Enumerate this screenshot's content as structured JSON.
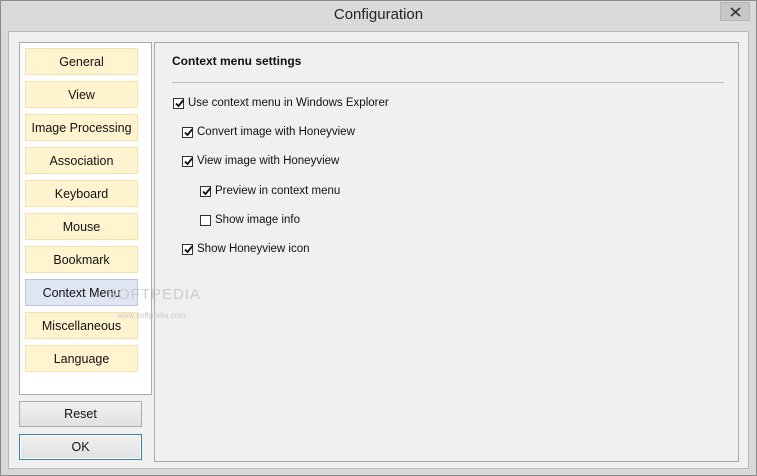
{
  "window": {
    "title": "Configuration"
  },
  "nav": {
    "items": [
      {
        "label": "General"
      },
      {
        "label": "View"
      },
      {
        "label": "Image Processing"
      },
      {
        "label": "Association"
      },
      {
        "label": "Keyboard"
      },
      {
        "label": "Mouse"
      },
      {
        "label": "Bookmark"
      },
      {
        "label": "Context Menu",
        "selected": true
      },
      {
        "label": "Miscellaneous"
      },
      {
        "label": "Language"
      }
    ]
  },
  "buttons": {
    "reset": "Reset",
    "ok": "OK"
  },
  "content": {
    "section_title": "Context menu settings",
    "options": [
      {
        "label": "Use context menu in Windows Explorer",
        "checked": true
      },
      {
        "label": "Convert image with Honeyview",
        "checked": true
      },
      {
        "label": "View image with Honeyview",
        "checked": true
      },
      {
        "label": "Preview in context menu",
        "checked": true
      },
      {
        "label": "Show image info",
        "checked": false
      },
      {
        "label": "Show Honeyview icon",
        "checked": true
      }
    ]
  },
  "watermark": {
    "text": "SOFTPEDIA",
    "url": "www.softpedia.com"
  },
  "colors": {
    "nav_item_bg": "#fff4cf",
    "nav_item_selected_bg": "#dfe5f3",
    "default_button_border": "#3c7fb1"
  },
  "icons": {
    "close": "close-icon",
    "checkbox_check": "checkmark-icon"
  }
}
